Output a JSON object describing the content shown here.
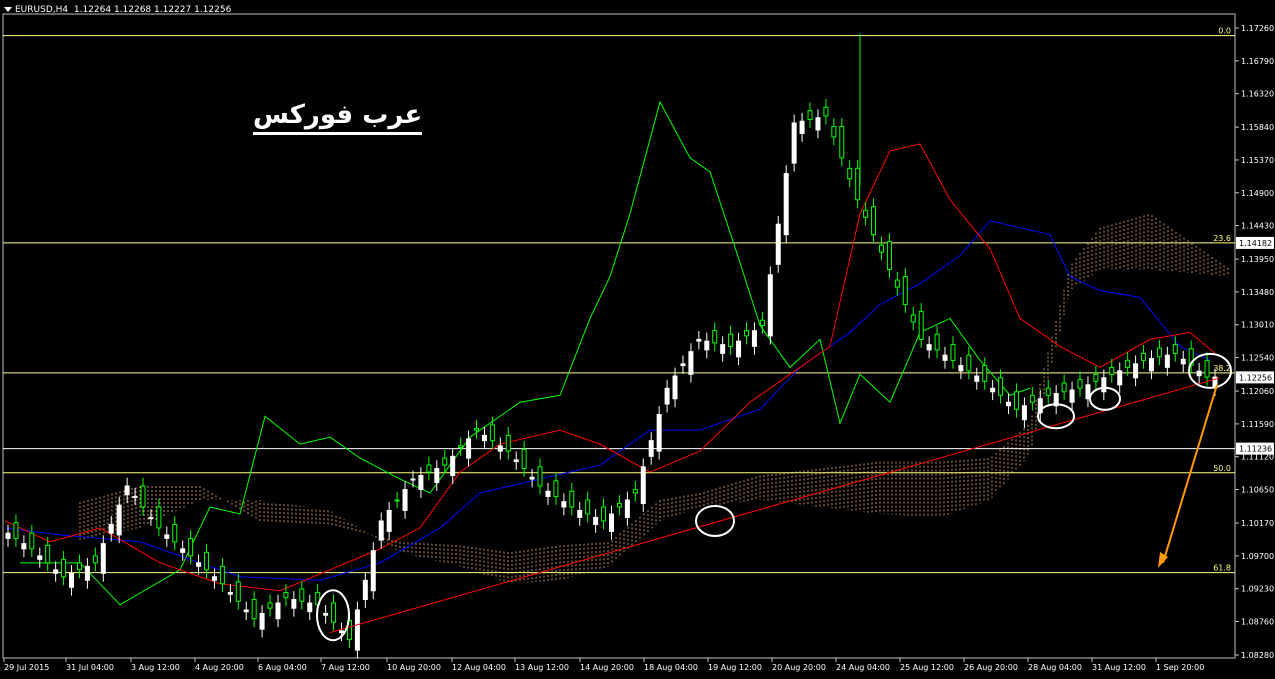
{
  "header": {
    "symbol": "EURUSD,H4",
    "ohlc": "1.12264 1.12268 1.12227 1.12256"
  },
  "watermark": "عرب فوركس",
  "price_axis": {
    "ticks": [
      "1.17260",
      "1.16790",
      "1.16320",
      "1.15840",
      "1.15370",
      "1.14900",
      "1.14430",
      "1.13950",
      "1.13480",
      "1.13010",
      "1.12540",
      "1.12060",
      "1.11590",
      "1.11120",
      "1.10650",
      "1.10170",
      "1.09700",
      "1.09230",
      "1.08760",
      "1.08280"
    ],
    "range": [
      1.0828,
      1.1726
    ],
    "highlighted_labels": [
      {
        "text": "1.14182",
        "value": 1.14182
      },
      {
        "text": "1.12256",
        "value": 1.12256
      },
      {
        "text": "1.11236",
        "value": 1.11236
      }
    ]
  },
  "time_axis": {
    "labels": [
      "29 Jul 2015",
      "31 Jul 04:00",
      "3 Aug 12:00",
      "4 Aug 20:00",
      "6 Aug 04:00",
      "7 Aug 12:00",
      "10 Aug 20:00",
      "12 Aug 04:00",
      "13 Aug 12:00",
      "14 Aug 20:00",
      "18 Aug 04:00",
      "19 Aug 12:00",
      "20 Aug 20:00",
      "24 Aug 04:00",
      "25 Aug 12:00",
      "26 Aug 20:00",
      "28 Aug 04:00",
      "31 Aug 12:00",
      "1 Sep 20:00"
    ]
  },
  "fibonacci": [
    {
      "label": "0.0",
      "value": 1.1715
    },
    {
      "label": "23.6",
      "value": 1.14182
    },
    {
      "label": "38.2",
      "value": 1.1232
    },
    {
      "label": "50.0",
      "value": 1.1089
    },
    {
      "label": "61.8",
      "value": 1.0946
    }
  ],
  "colors": {
    "background": "#000000",
    "bull_candle": "#ffffff",
    "bear_candle": "#00ff00",
    "tenkan": "#ff0000",
    "kijun": "#0000ff",
    "chikou": "#00ff00",
    "fib": "#ffff80",
    "trendline": "#ff0000",
    "arrow": "#ff9900",
    "cloud": "#e8a870",
    "axis_text": "#ffffff"
  },
  "chart_data": {
    "type": "candlestick",
    "series": [
      {
        "name": "EURUSD,H4",
        "close_approx": [
          1.101,
          1.098,
          1.094,
          1.096,
          1.107,
          1.101,
          1.097,
          1.093,
          1.088,
          1.091,
          1.09,
          1.085,
          1.102,
          1.108,
          1.11,
          1.115,
          1.112,
          1.107,
          1.104,
          1.102,
          1.106,
          1.121,
          1.128,
          1.127,
          1.13,
          1.159,
          1.16,
          1.148,
          1.138,
          1.128,
          1.125,
          1.122,
          1.118,
          1.12,
          1.121,
          1.123,
          1.125,
          1.126,
          1.1226
        ]
      }
    ],
    "ylim": [
      1.0828,
      1.1726
    ],
    "annotations": [
      "circle-low-7-aug",
      "circle-19-aug",
      "circle-28-aug",
      "circle-31-aug",
      "circle-1-sep",
      "trendline",
      "arrow-down"
    ]
  }
}
